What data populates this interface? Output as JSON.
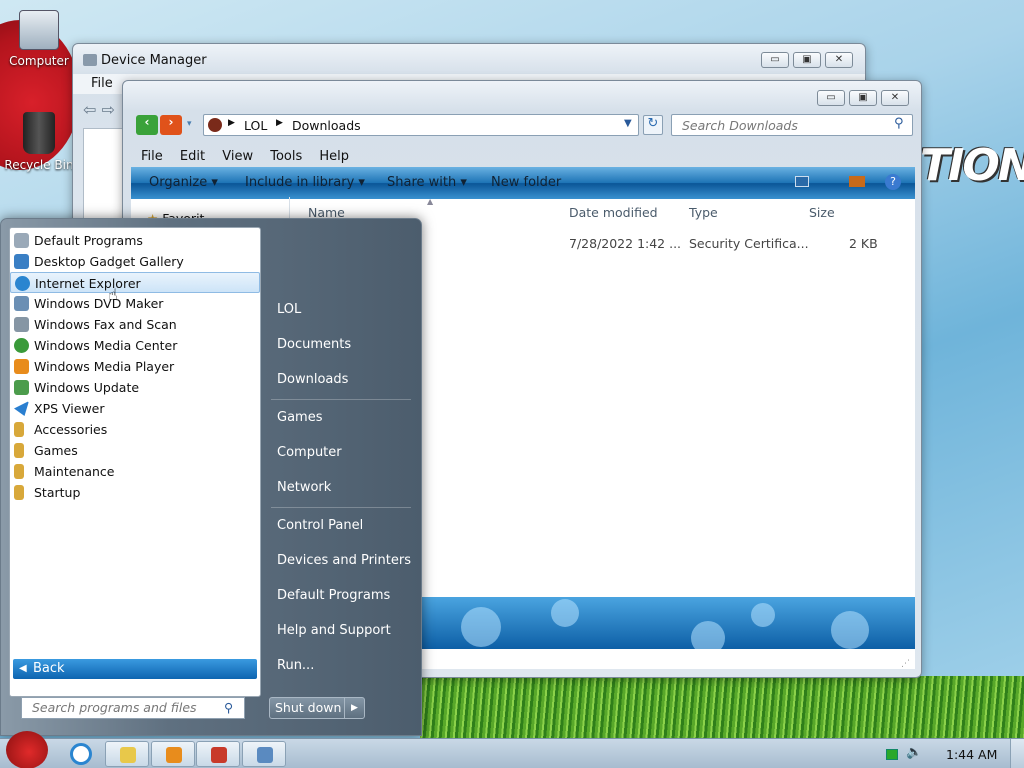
{
  "desktop": {
    "icons": [
      {
        "label": "Computer"
      },
      {
        "label": "Recycle Bin"
      }
    ],
    "banner": "TION"
  },
  "device_manager": {
    "title": "Device Manager",
    "menu": [
      "File"
    ],
    "controls": {
      "min": "▭",
      "max": "▣",
      "close": "✕"
    }
  },
  "explorer": {
    "breadcrumb": [
      "LOL",
      "Downloads"
    ],
    "search_placeholder": "Search Downloads",
    "menu": [
      "File",
      "Edit",
      "View",
      "Tools",
      "Help"
    ],
    "toolbar": {
      "organize": "Organize",
      "include": "Include in library",
      "share": "Share with",
      "new_folder": "New folder"
    },
    "columns": [
      "Name",
      "Date modified",
      "Type",
      "Size"
    ],
    "files": [
      {
        "date": "7/28/2022 1:42 ...",
        "type": "Security Certifica...",
        "size": "2 KB"
      }
    ],
    "nav_partial": "Favorit"
  },
  "start_menu": {
    "programs": [
      {
        "label": "Default Programs",
        "color": "#9aa9b8"
      },
      {
        "label": "Desktop Gadget Gallery",
        "color": "#3a7fc4"
      },
      {
        "label": "Internet Explorer",
        "color": "#2a85d0"
      },
      {
        "label": "Windows DVD Maker",
        "color": "#6b8fb4"
      },
      {
        "label": "Windows Fax and Scan",
        "color": "#8696a4"
      },
      {
        "label": "Windows Media Center",
        "color": "#3a9a3a"
      },
      {
        "label": "Windows Media Player",
        "color": "#e88c1c"
      },
      {
        "label": "Windows Update",
        "color": "#4c9c4c"
      },
      {
        "label": "XPS Viewer",
        "color": "#2a7fd0"
      },
      {
        "label": "Accessories",
        "color": "#d8a83a"
      },
      {
        "label": "Games",
        "color": "#d8a83a"
      },
      {
        "label": "Maintenance",
        "color": "#d8a83a"
      },
      {
        "label": "Startup",
        "color": "#d8a83a"
      }
    ],
    "back": "Back",
    "search_placeholder": "Search programs and files",
    "right": [
      "LOL",
      "Documents",
      "Downloads",
      "Games",
      "Computer",
      "Network",
      "Control Panel",
      "Devices and Printers",
      "Default Programs",
      "Help and Support",
      "Run..."
    ],
    "shutdown": "Shut down"
  },
  "taskbar": {
    "clock": "1:44 AM"
  }
}
